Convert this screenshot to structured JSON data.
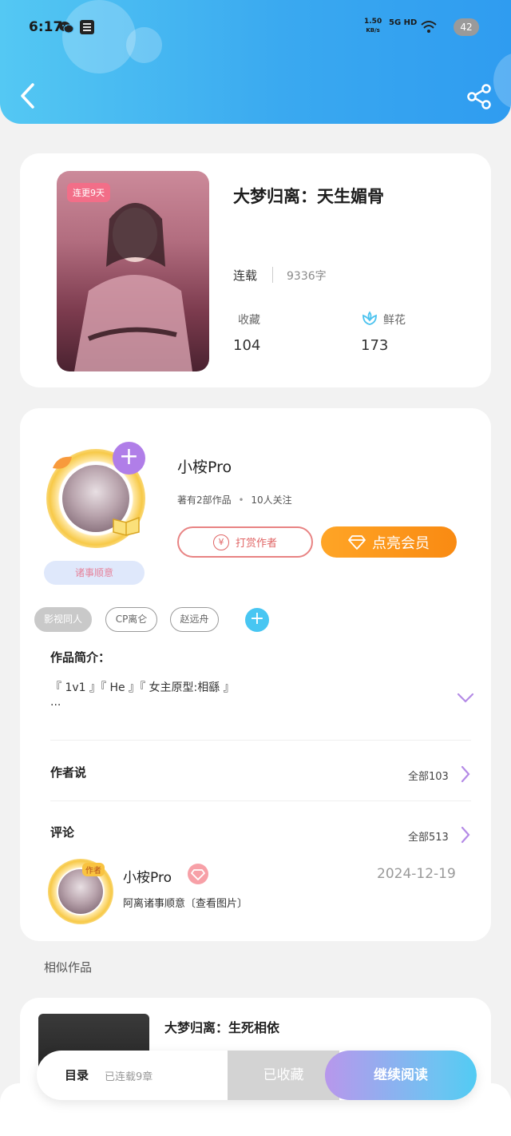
{
  "status_bar": {
    "time": "6:17",
    "net_speed_value": "1.50",
    "net_speed_unit": "KB/s",
    "network": "5G HD",
    "battery": "42"
  },
  "book": {
    "title": "大梦归离：天生媚骨",
    "cover_badge": "连更9天",
    "status": "连载",
    "word_count": "9336字",
    "favorites_label": "收藏",
    "favorites_value": "104",
    "flowers_label": "鲜花",
    "flowers_value": "173"
  },
  "author": {
    "name": "小桉Pro",
    "works": "著有2部作品",
    "followers": "10人关注",
    "wish_label": "诸事顺意",
    "tip_label": "打赏作者",
    "vip_label": "点亮会员"
  },
  "tags": [
    "影视同人",
    "CP离仑",
    "赵远舟"
  ],
  "intro": {
    "title": "作品简介：",
    "text": "『 1v1 』『 He 』『 女主原型:相繇 』",
    "ellipsis": "···"
  },
  "author_says": {
    "title": "作者说",
    "more": "全部103"
  },
  "comments": {
    "title": "评论",
    "more": "全部513",
    "items": [
      {
        "badge": "作者",
        "name": "小桉Pro",
        "date": "2024-12-19",
        "text": "阿离诸事顺意〔查看图片〕"
      }
    ]
  },
  "similar": {
    "title": "相似作品",
    "items": [
      {
        "title": "大梦归离：生死相依"
      }
    ]
  },
  "bottom": {
    "toc": "目录",
    "chapters": "已连载9章",
    "collected": "已收藏",
    "continue": "继续阅读"
  },
  "colors": {
    "header_blue": "#3aa9f0",
    "accent_orange": "#f98a12",
    "accent_purple": "#b07ee8",
    "accent_cyan": "#48c6f2"
  }
}
